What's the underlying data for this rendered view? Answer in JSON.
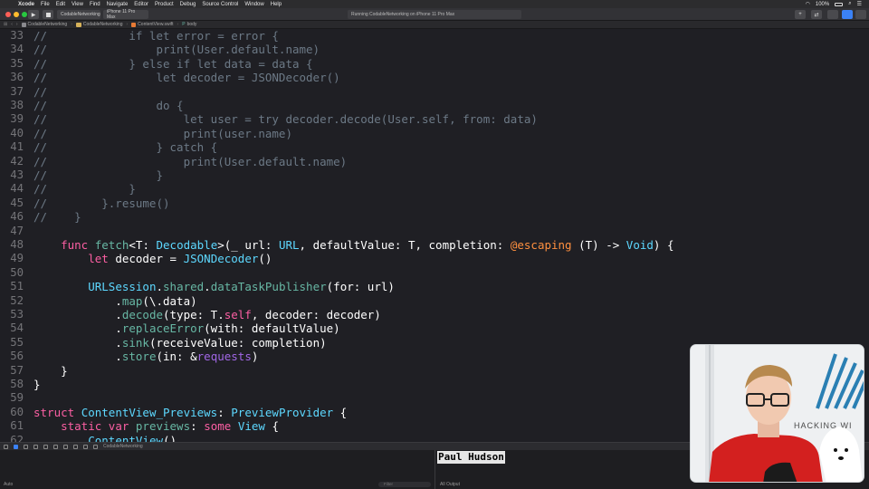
{
  "menubar": {
    "items": [
      "Xcode",
      "File",
      "Edit",
      "View",
      "Find",
      "Navigate",
      "Editor",
      "Product",
      "Debug",
      "Source Control",
      "Window",
      "Help"
    ],
    "battery": "100%",
    "wifi_icon": "wifi-icon",
    "search_icon": "spotlight-icon"
  },
  "toolbar": {
    "scheme": "CodableNetworking",
    "device": "iPhone 11 Pro Max",
    "activity": "Running CodableNetworking on iPhone 11 Pro Max",
    "run_icon": "play-icon",
    "stop_icon": "stop-icon"
  },
  "jumpbar": {
    "crumbs": [
      "CodableNetworking",
      "CodableNetworking",
      "ContentView.swift",
      "body"
    ]
  },
  "editor": {
    "lines": [
      {
        "n": "33",
        "t": [
          [
            "cm",
            "//            if let error = error {"
          ]
        ]
      },
      {
        "n": "34",
        "t": [
          [
            "cm",
            "//                print(User.default.name)"
          ]
        ]
      },
      {
        "n": "35",
        "t": [
          [
            "cm",
            "//            } else if let data = data {"
          ]
        ]
      },
      {
        "n": "36",
        "t": [
          [
            "cm",
            "//                let decoder = JSONDecoder()"
          ]
        ]
      },
      {
        "n": "37",
        "t": [
          [
            "cm",
            "//"
          ]
        ]
      },
      {
        "n": "38",
        "t": [
          [
            "cm",
            "//                do {"
          ]
        ]
      },
      {
        "n": "39",
        "t": [
          [
            "cm",
            "//                    let user = try decoder.decode(User.self, from: data)"
          ]
        ]
      },
      {
        "n": "40",
        "t": [
          [
            "cm",
            "//                    print(user.name)"
          ]
        ]
      },
      {
        "n": "41",
        "t": [
          [
            "cm",
            "//                } catch {"
          ]
        ]
      },
      {
        "n": "42",
        "t": [
          [
            "cm",
            "//                    print(User.default.name)"
          ]
        ]
      },
      {
        "n": "43",
        "t": [
          [
            "cm",
            "//                }"
          ]
        ]
      },
      {
        "n": "44",
        "t": [
          [
            "cm",
            "//            }"
          ]
        ]
      },
      {
        "n": "45",
        "t": [
          [
            "cm",
            "//        }.resume()"
          ]
        ]
      },
      {
        "n": "46",
        "t": [
          [
            "cm",
            "//    }"
          ]
        ]
      },
      {
        "n": "47",
        "t": []
      },
      {
        "n": "48",
        "t": [
          [
            "pl",
            "    "
          ],
          [
            "kw",
            "func"
          ],
          [
            "pl",
            " "
          ],
          [
            "fn",
            "fetch"
          ],
          [
            "pl",
            "<T: "
          ],
          [
            "ty",
            "Decodable"
          ],
          [
            "pl",
            ">(_ url: "
          ],
          [
            "ty",
            "URL"
          ],
          [
            "pl",
            ", defaultValue: T, completion: "
          ],
          [
            "ek",
            "@escaping"
          ],
          [
            "pl",
            " (T) -> "
          ],
          [
            "ty",
            "Void"
          ],
          [
            "pl",
            ") {"
          ]
        ]
      },
      {
        "n": "49",
        "t": [
          [
            "pl",
            "        "
          ],
          [
            "kw",
            "let"
          ],
          [
            "pl",
            " decoder = "
          ],
          [
            "ty",
            "JSONDecoder"
          ],
          [
            "pl",
            "()"
          ]
        ]
      },
      {
        "n": "50",
        "t": []
      },
      {
        "n": "51",
        "t": [
          [
            "pl",
            "        "
          ],
          [
            "ty",
            "URLSession"
          ],
          [
            "pl",
            "."
          ],
          [
            "fn",
            "shared"
          ],
          [
            "pl",
            "."
          ],
          [
            "fn",
            "dataTaskPublisher"
          ],
          [
            "pl",
            "(for: url)"
          ]
        ]
      },
      {
        "n": "52",
        "t": [
          [
            "pl",
            "            ."
          ],
          [
            "fn",
            "map"
          ],
          [
            "pl",
            "(\\.data)"
          ]
        ]
      },
      {
        "n": "53",
        "t": [
          [
            "pl",
            "            ."
          ],
          [
            "fn",
            "decode"
          ],
          [
            "pl",
            "(type: T."
          ],
          [
            "kw",
            "self"
          ],
          [
            "pl",
            ", decoder: decoder)"
          ]
        ]
      },
      {
        "n": "54",
        "t": [
          [
            "pl",
            "            ."
          ],
          [
            "fn",
            "replaceError"
          ],
          [
            "pl",
            "(with: defaultValue)"
          ]
        ]
      },
      {
        "n": "55",
        "t": [
          [
            "pl",
            "            ."
          ],
          [
            "fn",
            "sink"
          ],
          [
            "pl",
            "(receiveValue: completion)"
          ]
        ]
      },
      {
        "n": "56",
        "t": [
          [
            "pl",
            "            ."
          ],
          [
            "fn",
            "store"
          ],
          [
            "pl",
            "(in: &"
          ],
          [
            "pp",
            "requests"
          ],
          [
            "pl",
            ")"
          ]
        ]
      },
      {
        "n": "57",
        "t": [
          [
            "pl",
            "    }"
          ]
        ]
      },
      {
        "n": "58",
        "t": [
          [
            "pl",
            "}"
          ]
        ]
      },
      {
        "n": "59",
        "t": []
      },
      {
        "n": "60",
        "t": [
          [
            "kw",
            "struct"
          ],
          [
            "pl",
            " "
          ],
          [
            "ty",
            "ContentView_Previews"
          ],
          [
            "pl",
            ": "
          ],
          [
            "ty",
            "PreviewProvider"
          ],
          [
            "pl",
            " {"
          ]
        ]
      },
      {
        "n": "61",
        "t": [
          [
            "pl",
            "    "
          ],
          [
            "kw",
            "static"
          ],
          [
            "pl",
            " "
          ],
          [
            "kw",
            "var"
          ],
          [
            "pl",
            " "
          ],
          [
            "fn",
            "previews"
          ],
          [
            "pl",
            ": "
          ],
          [
            "kw",
            "some"
          ],
          [
            "pl",
            " "
          ],
          [
            "ty",
            "View"
          ],
          [
            "pl",
            " {"
          ]
        ]
      },
      {
        "n": "62",
        "t": [
          [
            "pl",
            "        "
          ],
          [
            "ty",
            "ContentView"
          ],
          [
            "pl",
            "()"
          ]
        ]
      }
    ]
  },
  "debugbar": {
    "project": "CodableNetworking"
  },
  "debugarea": {
    "left_mode": "Auto",
    "filter_placeholder": "Filter",
    "right_mode": "All Output"
  },
  "caption": "Paul Hudson",
  "webcam": {
    "banner_text": "HACKING WI",
    "shirt_color": "#d3201f"
  }
}
